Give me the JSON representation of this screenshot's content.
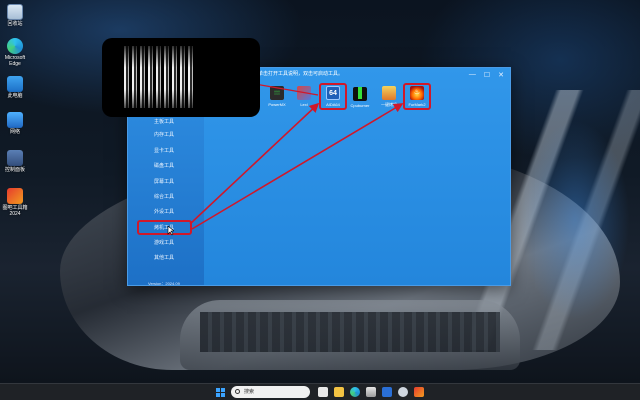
{
  "desktop": {
    "icons": [
      {
        "label": "回收站",
        "icon": "recycle-bin-icon"
      },
      {
        "label": "Microsoft Edge",
        "icon": "edge-icon"
      },
      {
        "label": "此电脑",
        "icon": "computer-icon"
      },
      {
        "label": "网络",
        "icon": "network-icon"
      },
      {
        "label": "控制面板",
        "icon": "control-panel-icon"
      },
      {
        "label": "图吧工具箱 2024",
        "icon": "toolbox-icon"
      }
    ]
  },
  "window": {
    "hint": "单击打开工具说明，双击可启动工具。",
    "controls": {
      "minimize": "—",
      "maximize": "☐",
      "close": "✕"
    },
    "sidebar": {
      "items": [
        {
          "label": "主板工具"
        },
        {
          "label": "内存工具"
        },
        {
          "label": "显卡工具"
        },
        {
          "label": "磁盘工具"
        },
        {
          "label": "屏幕工具"
        },
        {
          "label": "综合工具"
        },
        {
          "label": "外设工具"
        },
        {
          "label": "烤机工具"
        },
        {
          "label": "游戏工具"
        },
        {
          "label": "其他工具"
        }
      ],
      "active": "烤机工具",
      "version": "Version：2024.09"
    },
    "tools": [
      {
        "label": "PowerMX",
        "tile_text": "▒▒"
      },
      {
        "label": "Lexl",
        "tile_text": ""
      },
      {
        "label": "AIDA64",
        "tile_text": "64"
      },
      {
        "label": "Cpuburner",
        "tile_text": ""
      },
      {
        "label": "一键烤机",
        "tile_text": ""
      },
      {
        "label": "FurMark2",
        "tile_text": "♨"
      }
    ]
  },
  "taskbar": {
    "search_placeholder": "搜索"
  },
  "colors": {
    "highlight": "#d0182a",
    "window_blue": "#2c8ae0"
  }
}
